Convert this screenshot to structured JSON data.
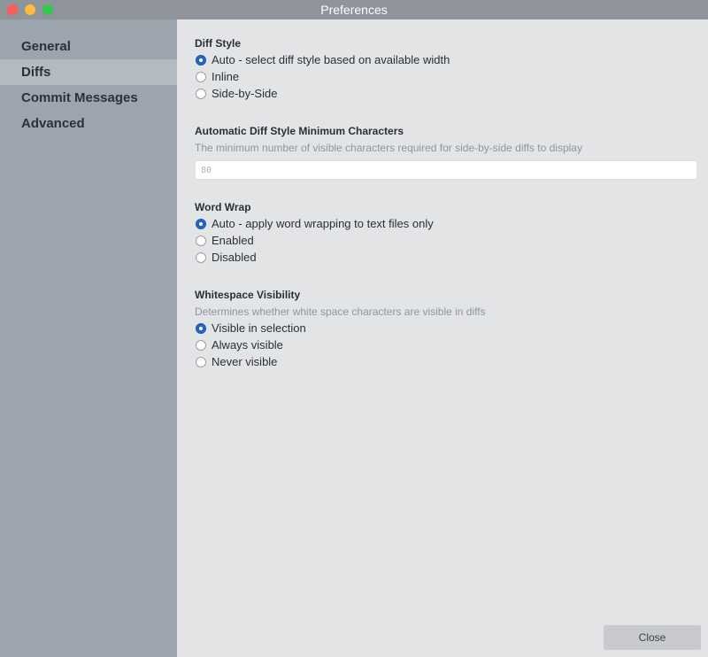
{
  "window": {
    "title": "Preferences"
  },
  "sidebar": {
    "items": [
      {
        "label": "General",
        "selected": false
      },
      {
        "label": "Diffs",
        "selected": true
      },
      {
        "label": "Commit Messages",
        "selected": false
      },
      {
        "label": "Advanced",
        "selected": false
      }
    ]
  },
  "diff_style": {
    "title": "Diff Style",
    "options": [
      {
        "label": "Auto - select diff style based on available width",
        "checked": true
      },
      {
        "label": "Inline",
        "checked": false
      },
      {
        "label": "Side-by-Side",
        "checked": false
      }
    ]
  },
  "min_chars": {
    "title": "Automatic Diff Style Minimum Characters",
    "description": "The minimum number of visible characters required for side-by-side diffs to display",
    "placeholder": "80"
  },
  "word_wrap": {
    "title": "Word Wrap",
    "options": [
      {
        "label": "Auto - apply word wrapping to text files only",
        "checked": true
      },
      {
        "label": "Enabled",
        "checked": false
      },
      {
        "label": "Disabled",
        "checked": false
      }
    ]
  },
  "whitespace": {
    "title": "Whitespace Visibility",
    "description": "Determines whether white space characters are visible in diffs",
    "options": [
      {
        "label": "Visible in selection",
        "checked": true
      },
      {
        "label": "Always visible",
        "checked": false
      },
      {
        "label": "Never visible",
        "checked": false
      }
    ]
  },
  "footer": {
    "close_label": "Close"
  },
  "colors": {
    "accent": "#2466c8",
    "sidebar": "#9ca4ad",
    "sidebar_selected": "#b4bac1",
    "titlebar": "#8f949b"
  }
}
